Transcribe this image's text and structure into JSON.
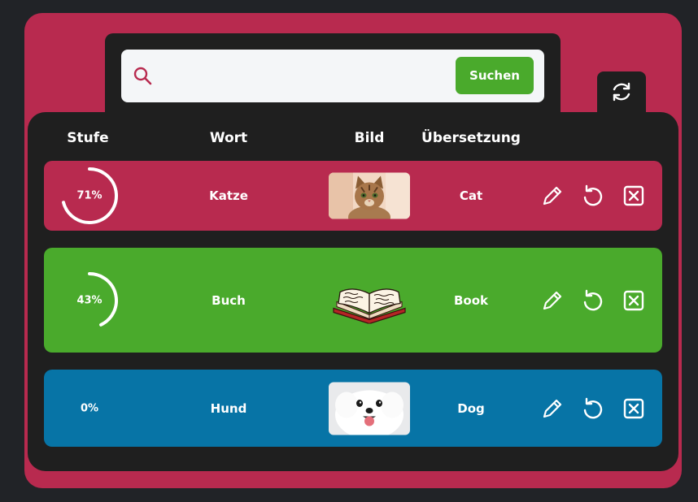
{
  "search": {
    "placeholder": "",
    "button_label": "Suchen"
  },
  "table": {
    "headers": {
      "level": "Stufe",
      "word": "Wort",
      "image": "Bild",
      "translation": "Übersetzung"
    },
    "rows": [
      {
        "level_label": "71%",
        "level": 71,
        "word": "Katze",
        "translation": "Cat",
        "image": "cat",
        "color": "#b82a4f"
      },
      {
        "level_label": "43%",
        "level": 43,
        "word": "Buch",
        "translation": "Book",
        "image": "book",
        "color": "#4aaa2c"
      },
      {
        "level_label": "0%",
        "level": 0,
        "word": "Hund",
        "translation": "Dog",
        "image": "dog",
        "color": "#0774a6"
      }
    ]
  },
  "colors": {
    "frame": "#b82a4f",
    "panel": "#1f1f1f",
    "accent": "#4aaa2c"
  },
  "icons": [
    "search-icon",
    "refresh-icon",
    "edit-icon",
    "reset-icon",
    "delete-icon"
  ]
}
